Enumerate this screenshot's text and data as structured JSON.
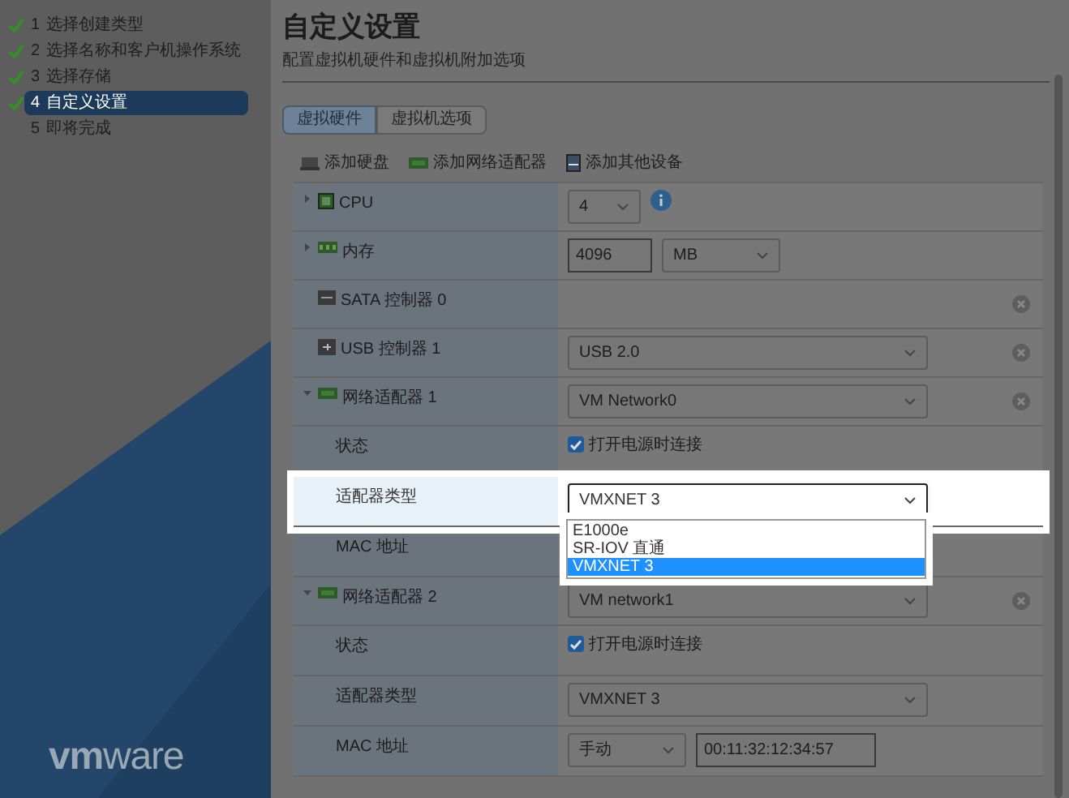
{
  "wizard_steps": [
    {
      "number": "1",
      "label": "选择创建类型",
      "completed": true,
      "selected": false
    },
    {
      "number": "2",
      "label": "选择名称和客户机操作系统",
      "completed": true,
      "selected": false
    },
    {
      "number": "3",
      "label": "选择存储",
      "completed": true,
      "selected": false
    },
    {
      "number": "4",
      "label": "自定义设置",
      "completed": true,
      "selected": true
    },
    {
      "number": "5",
      "label": "即将完成",
      "completed": false,
      "selected": false
    }
  ],
  "logo": "**vm**ware",
  "title": "自定义设置",
  "subtitle": "配置虚拟机硬件和虚拟机附加选项",
  "tabs": [
    {
      "label": "虚拟硬件",
      "selected": true
    },
    {
      "label": "虚拟机选项",
      "selected": false
    }
  ],
  "toolbar": [
    {
      "label": "添加硬盘",
      "kind": "disk"
    },
    {
      "label": "添加网络适配器",
      "kind": "nic"
    },
    {
      "label": "添加其他设备",
      "kind": "device"
    }
  ],
  "hardware": [
    {
      "label": "CPU",
      "kind": "cpu",
      "expanded": false,
      "controls": [
        {
          "kind": "compact_select",
          "value": "4"
        },
        {
          "kind": "info"
        }
      ]
    },
    {
      "label": "内存",
      "kind": "memory",
      "expanded": false,
      "controls": [
        {
          "kind": "input",
          "value": "4096"
        },
        {
          "kind": "unit_select",
          "value": "MB"
        }
      ]
    },
    {
      "label": "SATA 控制器 0",
      "kind": "sata",
      "removable": true
    },
    {
      "label": "USB 控制器 1",
      "kind": "usb",
      "removable": true,
      "controls": [
        {
          "kind": "select",
          "value": "USB 2.0"
        }
      ]
    },
    {
      "label": "网络适配器 1",
      "kind": "nic",
      "expanded": true,
      "removable": true,
      "controls": [
        {
          "kind": "select",
          "value": "VM Network0"
        }
      ],
      "children": [
        {
          "label": "状态",
          "controls": [
            {
              "kind": "checkbox",
              "checked": true,
              "label": "打开电源时连接"
            }
          ]
        },
        {
          "label": "适配器类型",
          "controls": [
            {
              "kind": "select",
              "value": "VMXNET 3",
              "open": true,
              "options": [
                {
                  "label": "E1000e",
                  "selected": false
                },
                {
                  "label": "SR-IOV 直通",
                  "selected": false
                },
                {
                  "label": "VMXNET 3",
                  "selected": true
                }
              ]
            }
          ]
        },
        {
          "label": "MAC 地址"
        }
      ]
    },
    {
      "label": "网络适配器 2",
      "kind": "nic",
      "expanded": true,
      "removable": true,
      "controls": [
        {
          "kind": "select",
          "value": "VM network1"
        }
      ],
      "children": [
        {
          "label": "状态",
          "controls": [
            {
              "kind": "checkbox",
              "checked": true,
              "label": "打开电源时连接"
            }
          ]
        },
        {
          "label": "适配器类型",
          "controls": [
            {
              "kind": "select",
              "value": "VMXNET 3",
              "open": false
            }
          ]
        },
        {
          "label": "MAC 地址",
          "controls": [
            {
              "kind": "mode_select",
              "value": "手动"
            },
            {
              "kind": "input_wide",
              "value": "00:11:32:12:34:57"
            }
          ]
        }
      ]
    }
  ]
}
